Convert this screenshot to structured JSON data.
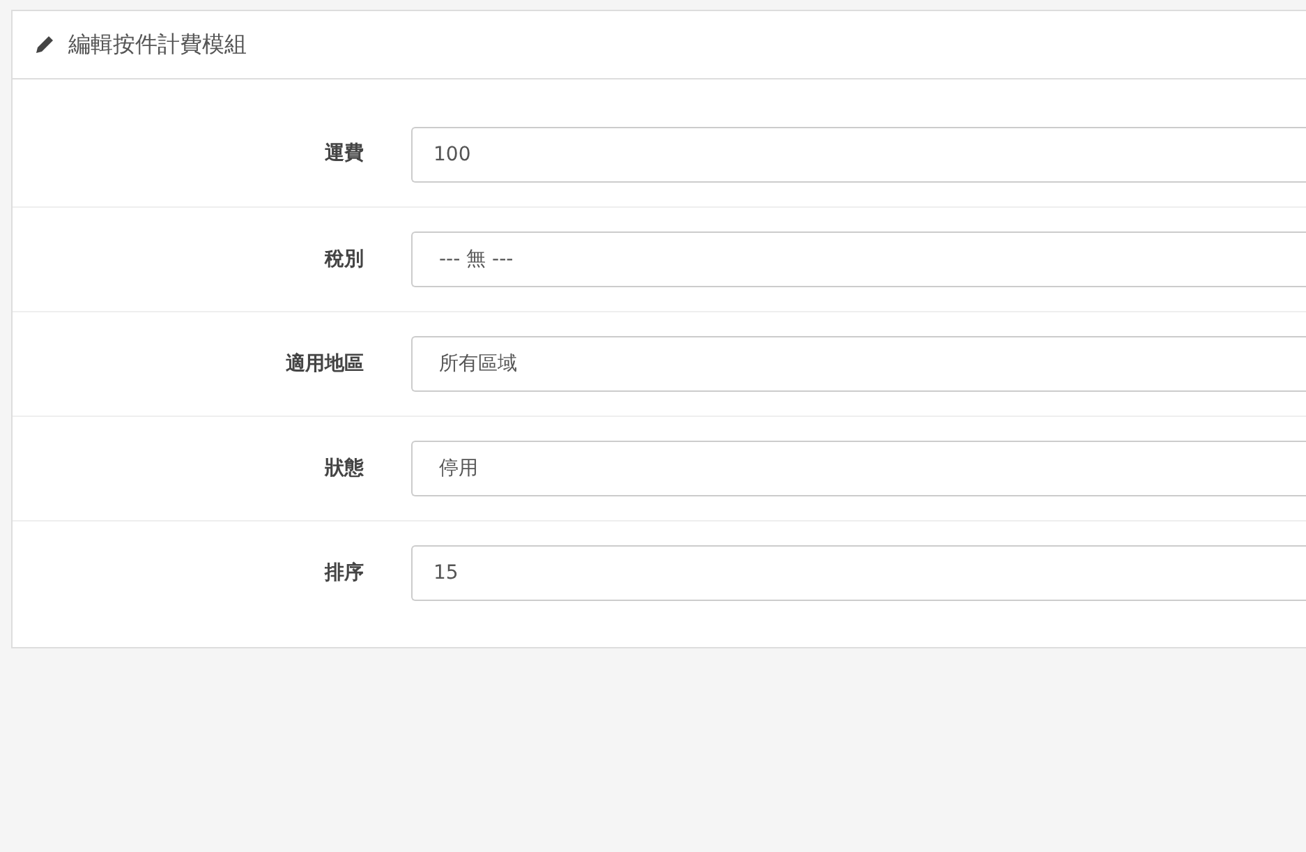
{
  "panel": {
    "title": "編輯按件計費模組"
  },
  "fields": [
    {
      "label": "運費",
      "kind": "input",
      "value": "100"
    },
    {
      "label": "稅別",
      "kind": "select",
      "value": "--- 無 ---"
    },
    {
      "label": "適用地區",
      "kind": "select",
      "value": "所有區域"
    },
    {
      "label": "狀態",
      "kind": "select",
      "value": "停用"
    },
    {
      "label": "排序",
      "kind": "input",
      "value": "15"
    }
  ]
}
